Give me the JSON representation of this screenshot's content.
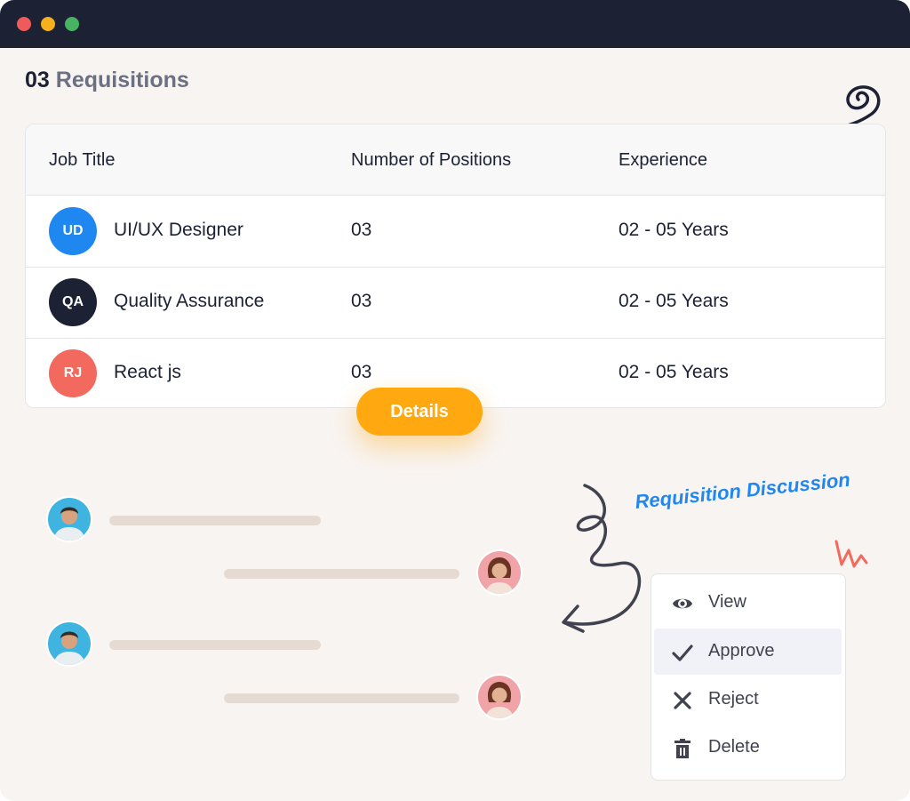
{
  "window": {
    "controls": [
      "close",
      "minimize",
      "maximize"
    ]
  },
  "heading": {
    "count": "03",
    "label": "Requisitions"
  },
  "table": {
    "columns": [
      "Job Title",
      "Number of Positions",
      "Experience"
    ],
    "rows": [
      {
        "initials": "UD",
        "avatar_color": "#1f87f0",
        "title": "UI/UX Designer",
        "positions": "03",
        "experience": "02 - 05 Years"
      },
      {
        "initials": "QA",
        "avatar_color": "#1c2134",
        "title": "Quality Assurance",
        "positions": "03",
        "experience": "02 - 05 Years"
      },
      {
        "initials": "RJ",
        "avatar_color": "#f26a5e",
        "title": "React js",
        "positions": "03",
        "experience": "02 - 05 Years"
      }
    ]
  },
  "details_button": {
    "label": "Details",
    "color": "#ffa80f"
  },
  "discussion": {
    "label": "Requisition Discussion",
    "label_color": "#1f87f0"
  },
  "context_menu": {
    "items": [
      {
        "label": "View",
        "icon": "eye-icon"
      },
      {
        "label": "Approve",
        "icon": "check-icon",
        "active": true
      },
      {
        "label": "Reject",
        "icon": "close-icon"
      },
      {
        "label": "Delete",
        "icon": "trash-icon"
      }
    ]
  }
}
